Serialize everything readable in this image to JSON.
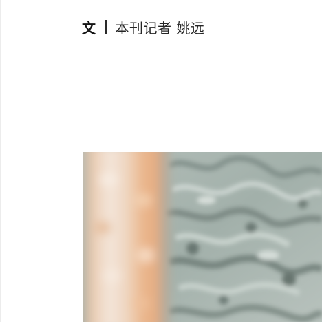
{
  "byline": {
    "prefix": "文",
    "author": "本刊记者 姚远"
  },
  "photo": {
    "subject": "blurred-carved-stone-relief",
    "colors": {
      "stone": "#a6b4ae",
      "stone_shadow": "#6f7d78",
      "warm_column": "#e9b58a",
      "pale_column": "#f1ddcd"
    }
  }
}
